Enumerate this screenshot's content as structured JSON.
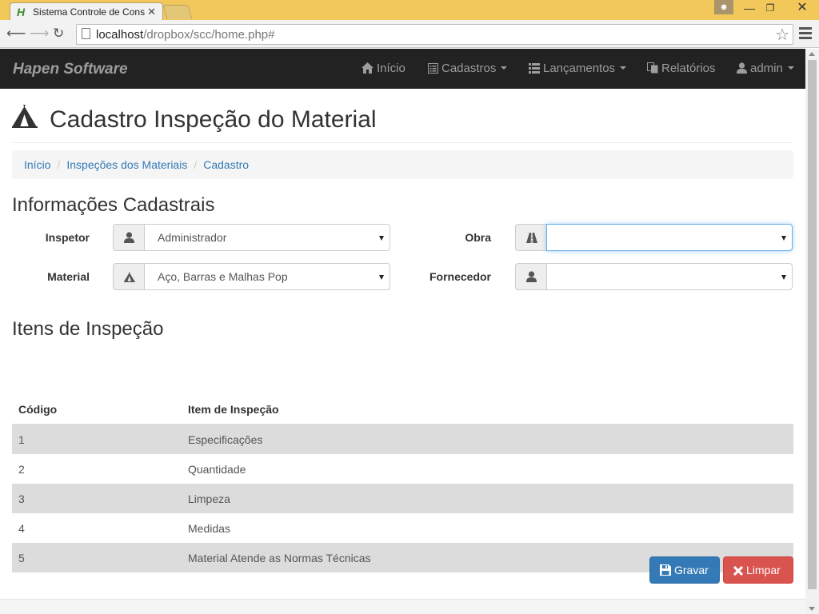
{
  "browser": {
    "tab_title": "Sistema Controle de Cons",
    "url_host": "localhost",
    "url_path": "/dropbox/scc/home.php#"
  },
  "navbar": {
    "brand": "Hapen Software",
    "items": [
      {
        "label": "Início",
        "icon": "home-icon"
      },
      {
        "label": "Cadastros",
        "icon": "list-alt-icon",
        "dropdown": true
      },
      {
        "label": "Lançamentos",
        "icon": "list-icon",
        "dropdown": true
      },
      {
        "label": "Relatórios",
        "icon": "copy-icon"
      },
      {
        "label": "admin",
        "icon": "user-icon",
        "dropdown": true
      }
    ]
  },
  "page": {
    "title": "Cadastro Inspeção do Material",
    "title_icon": "tent-icon"
  },
  "breadcrumb": [
    "Início",
    "Inspeções dos Materiais",
    "Cadastro"
  ],
  "form": {
    "section_title": "Informações Cadastrais",
    "fields": {
      "inspetor": {
        "label": "Inspetor",
        "value": "Administrador",
        "icon": "user-icon"
      },
      "obra": {
        "label": "Obra",
        "value": "",
        "icon": "road-icon"
      },
      "material": {
        "label": "Material",
        "value": "Aço, Barras e Malhas Pop",
        "icon": "tent-icon"
      },
      "fornecedor": {
        "label": "Fornecedor",
        "value": "",
        "icon": "user-icon"
      }
    }
  },
  "items": {
    "section_title": "Itens de Inspeção",
    "columns": [
      "Código",
      "Item de Inspeção"
    ],
    "rows": [
      [
        "1",
        "Especificações"
      ],
      [
        "2",
        "Quantidade"
      ],
      [
        "3",
        "Limpeza"
      ],
      [
        "4",
        "Medidas"
      ],
      [
        "5",
        "Material Atende as Normas Técnicas"
      ]
    ]
  },
  "actions": {
    "save_label": "Gravar",
    "clear_label": "Limpar"
  },
  "colors": {
    "primary": "#337ab7",
    "danger": "#d9534f",
    "navbar": "#222222",
    "chrome_frame": "#f2c85b"
  }
}
